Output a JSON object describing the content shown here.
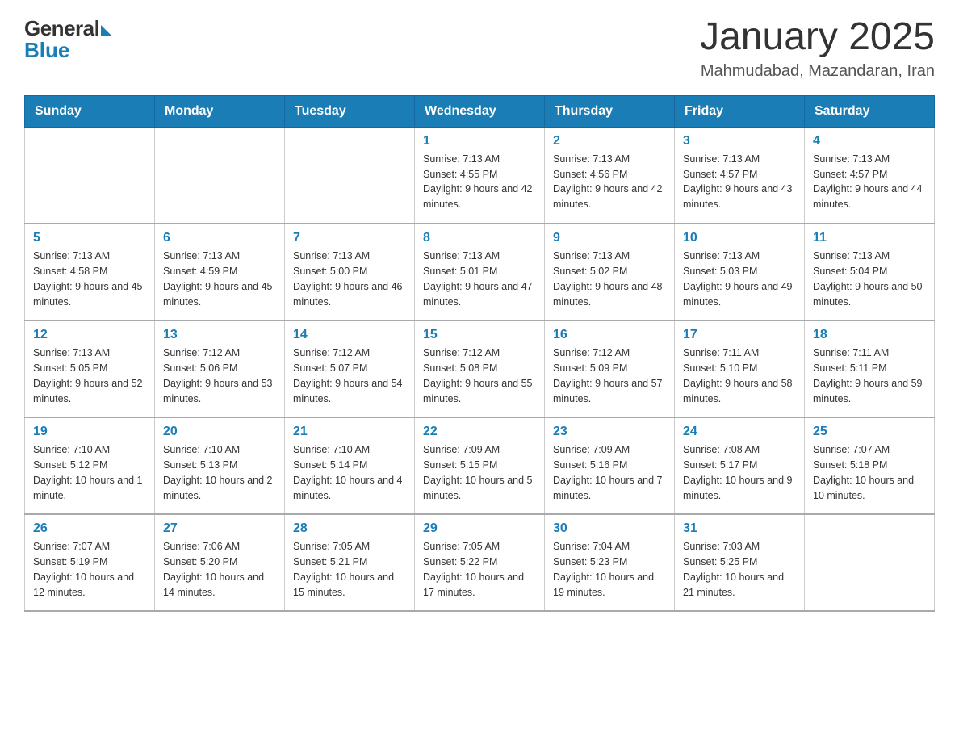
{
  "header": {
    "logo_general": "General",
    "logo_blue": "Blue",
    "month_title": "January 2025",
    "location": "Mahmudabad, Mazandaran, Iran"
  },
  "calendar": {
    "days_of_week": [
      "Sunday",
      "Monday",
      "Tuesday",
      "Wednesday",
      "Thursday",
      "Friday",
      "Saturday"
    ],
    "weeks": [
      [
        {
          "day": "",
          "info": ""
        },
        {
          "day": "",
          "info": ""
        },
        {
          "day": "",
          "info": ""
        },
        {
          "day": "1",
          "info": "Sunrise: 7:13 AM\nSunset: 4:55 PM\nDaylight: 9 hours and 42 minutes."
        },
        {
          "day": "2",
          "info": "Sunrise: 7:13 AM\nSunset: 4:56 PM\nDaylight: 9 hours and 42 minutes."
        },
        {
          "day": "3",
          "info": "Sunrise: 7:13 AM\nSunset: 4:57 PM\nDaylight: 9 hours and 43 minutes."
        },
        {
          "day": "4",
          "info": "Sunrise: 7:13 AM\nSunset: 4:57 PM\nDaylight: 9 hours and 44 minutes."
        }
      ],
      [
        {
          "day": "5",
          "info": "Sunrise: 7:13 AM\nSunset: 4:58 PM\nDaylight: 9 hours and 45 minutes."
        },
        {
          "day": "6",
          "info": "Sunrise: 7:13 AM\nSunset: 4:59 PM\nDaylight: 9 hours and 45 minutes."
        },
        {
          "day": "7",
          "info": "Sunrise: 7:13 AM\nSunset: 5:00 PM\nDaylight: 9 hours and 46 minutes."
        },
        {
          "day": "8",
          "info": "Sunrise: 7:13 AM\nSunset: 5:01 PM\nDaylight: 9 hours and 47 minutes."
        },
        {
          "day": "9",
          "info": "Sunrise: 7:13 AM\nSunset: 5:02 PM\nDaylight: 9 hours and 48 minutes."
        },
        {
          "day": "10",
          "info": "Sunrise: 7:13 AM\nSunset: 5:03 PM\nDaylight: 9 hours and 49 minutes."
        },
        {
          "day": "11",
          "info": "Sunrise: 7:13 AM\nSunset: 5:04 PM\nDaylight: 9 hours and 50 minutes."
        }
      ],
      [
        {
          "day": "12",
          "info": "Sunrise: 7:13 AM\nSunset: 5:05 PM\nDaylight: 9 hours and 52 minutes."
        },
        {
          "day": "13",
          "info": "Sunrise: 7:12 AM\nSunset: 5:06 PM\nDaylight: 9 hours and 53 minutes."
        },
        {
          "day": "14",
          "info": "Sunrise: 7:12 AM\nSunset: 5:07 PM\nDaylight: 9 hours and 54 minutes."
        },
        {
          "day": "15",
          "info": "Sunrise: 7:12 AM\nSunset: 5:08 PM\nDaylight: 9 hours and 55 minutes."
        },
        {
          "day": "16",
          "info": "Sunrise: 7:12 AM\nSunset: 5:09 PM\nDaylight: 9 hours and 57 minutes."
        },
        {
          "day": "17",
          "info": "Sunrise: 7:11 AM\nSunset: 5:10 PM\nDaylight: 9 hours and 58 minutes."
        },
        {
          "day": "18",
          "info": "Sunrise: 7:11 AM\nSunset: 5:11 PM\nDaylight: 9 hours and 59 minutes."
        }
      ],
      [
        {
          "day": "19",
          "info": "Sunrise: 7:10 AM\nSunset: 5:12 PM\nDaylight: 10 hours and 1 minute."
        },
        {
          "day": "20",
          "info": "Sunrise: 7:10 AM\nSunset: 5:13 PM\nDaylight: 10 hours and 2 minutes."
        },
        {
          "day": "21",
          "info": "Sunrise: 7:10 AM\nSunset: 5:14 PM\nDaylight: 10 hours and 4 minutes."
        },
        {
          "day": "22",
          "info": "Sunrise: 7:09 AM\nSunset: 5:15 PM\nDaylight: 10 hours and 5 minutes."
        },
        {
          "day": "23",
          "info": "Sunrise: 7:09 AM\nSunset: 5:16 PM\nDaylight: 10 hours and 7 minutes."
        },
        {
          "day": "24",
          "info": "Sunrise: 7:08 AM\nSunset: 5:17 PM\nDaylight: 10 hours and 9 minutes."
        },
        {
          "day": "25",
          "info": "Sunrise: 7:07 AM\nSunset: 5:18 PM\nDaylight: 10 hours and 10 minutes."
        }
      ],
      [
        {
          "day": "26",
          "info": "Sunrise: 7:07 AM\nSunset: 5:19 PM\nDaylight: 10 hours and 12 minutes."
        },
        {
          "day": "27",
          "info": "Sunrise: 7:06 AM\nSunset: 5:20 PM\nDaylight: 10 hours and 14 minutes."
        },
        {
          "day": "28",
          "info": "Sunrise: 7:05 AM\nSunset: 5:21 PM\nDaylight: 10 hours and 15 minutes."
        },
        {
          "day": "29",
          "info": "Sunrise: 7:05 AM\nSunset: 5:22 PM\nDaylight: 10 hours and 17 minutes."
        },
        {
          "day": "30",
          "info": "Sunrise: 7:04 AM\nSunset: 5:23 PM\nDaylight: 10 hours and 19 minutes."
        },
        {
          "day": "31",
          "info": "Sunrise: 7:03 AM\nSunset: 5:25 PM\nDaylight: 10 hours and 21 minutes."
        },
        {
          "day": "",
          "info": ""
        }
      ]
    ]
  }
}
